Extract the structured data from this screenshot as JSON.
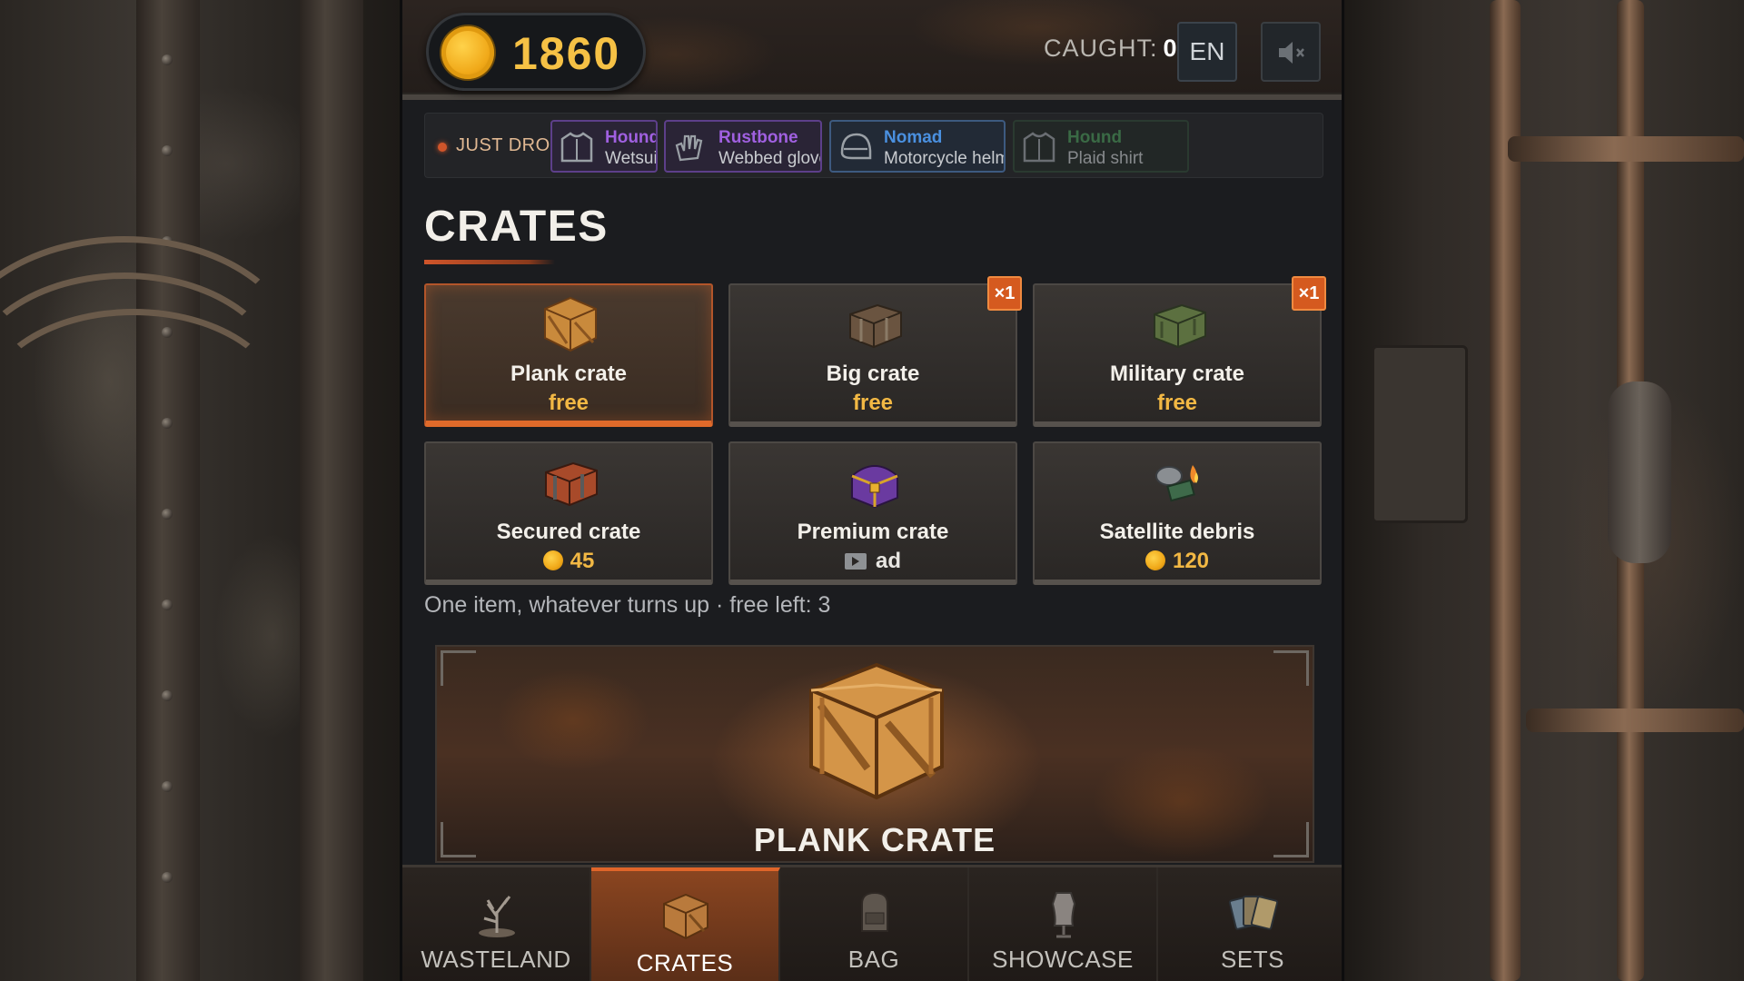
{
  "header": {
    "coins": "1860",
    "caught_label": "CAUGHT:",
    "caught_value": "0",
    "language": "EN",
    "sound_icon": "speaker-muted-icon"
  },
  "drops": {
    "label": "JUST DROPPED",
    "items": [
      {
        "name": "Hound",
        "item": "Wetsuit",
        "icon": "shirt-icon",
        "color": "#a060e0"
      },
      {
        "name": "Rustbone",
        "item": "Webbed gloves",
        "icon": "gloves-icon",
        "color": "#a060e0"
      },
      {
        "name": "Nomad",
        "item": "Motorcycle helmet",
        "icon": "helmet-icon",
        "color": "#4a90e0"
      },
      {
        "name": "Hound",
        "item": "Plaid shirt",
        "icon": "shirt-icon",
        "color": "#4a9a5a"
      }
    ]
  },
  "crates": {
    "title": "CRATES",
    "items": [
      {
        "name": "Plank crate",
        "price": "free",
        "badge": "",
        "icon": "plank-crate-icon"
      },
      {
        "name": "Big crate",
        "price": "free",
        "badge": "×1",
        "icon": "big-crate-icon"
      },
      {
        "name": "Military crate",
        "price": "free",
        "badge": "×1",
        "icon": "military-crate-icon"
      },
      {
        "name": "Secured crate",
        "price": "45",
        "badge": "",
        "icon": "secured-crate-icon"
      },
      {
        "name": "Premium crate",
        "price": "ad",
        "badge": "",
        "icon": "premium-crate-icon"
      },
      {
        "name": "Satellite debris",
        "price": "120",
        "badge": "",
        "icon": "satellite-debris-icon"
      }
    ],
    "hint": "One item, whatever turns up · free left: 3"
  },
  "stage": {
    "title": "PLANK CRATE"
  },
  "nav": {
    "items": [
      {
        "label": "WASTELAND",
        "icon": "dead-tree-icon"
      },
      {
        "label": "CRATES",
        "icon": "crate-icon"
      },
      {
        "label": "BAG",
        "icon": "backpack-icon"
      },
      {
        "label": "SHOWCASE",
        "icon": "mannequin-icon"
      },
      {
        "label": "SETS",
        "icon": "cards-icon"
      }
    ],
    "active": "CRATES"
  },
  "colors": {
    "accent": "#e0652a",
    "gold": "#f6c145",
    "panel": "#1b1c1f"
  }
}
